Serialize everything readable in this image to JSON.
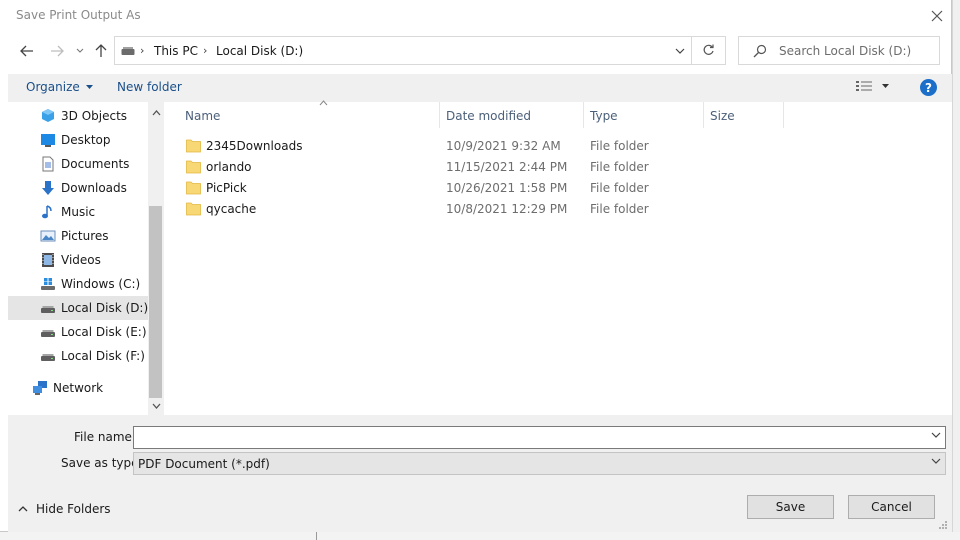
{
  "dialog": {
    "title": "Save Print Output As"
  },
  "address": {
    "crumbs": [
      "This PC",
      "Local Disk (D:)"
    ]
  },
  "search": {
    "placeholder": "Search Local Disk (D:)"
  },
  "toolbar": {
    "organize_label": "Organize",
    "new_folder_label": "New folder",
    "help_label": "?"
  },
  "sidebar": {
    "items": [
      {
        "label": "3D Objects",
        "icon": "3d-objects-icon"
      },
      {
        "label": "Desktop",
        "icon": "desktop-icon"
      },
      {
        "label": "Documents",
        "icon": "documents-icon"
      },
      {
        "label": "Downloads",
        "icon": "downloads-icon"
      },
      {
        "label": "Music",
        "icon": "music-icon"
      },
      {
        "label": "Pictures",
        "icon": "pictures-icon"
      },
      {
        "label": "Videos",
        "icon": "videos-icon"
      },
      {
        "label": "Windows (C:)",
        "icon": "windows-drive-icon"
      },
      {
        "label": "Local Disk (D:)",
        "icon": "drive-icon",
        "selected": true
      },
      {
        "label": "Local Disk (E:)",
        "icon": "drive-icon"
      },
      {
        "label": "Local Disk (F:)",
        "icon": "drive-icon"
      },
      {
        "label": "Network",
        "icon": "network-icon"
      }
    ]
  },
  "files": {
    "columns": [
      "Name",
      "Date modified",
      "Type",
      "Size"
    ],
    "rows": [
      {
        "name": "2345Downloads",
        "date": "10/9/2021 9:32 AM",
        "type": "File folder"
      },
      {
        "name": "orlando",
        "date": "11/15/2021 2:44 PM",
        "type": "File folder"
      },
      {
        "name": "PicPick",
        "date": "10/26/2021 1:58 PM",
        "type": "File folder"
      },
      {
        "name": "qycache",
        "date": "10/8/2021 12:29 PM",
        "type": "File folder"
      }
    ]
  },
  "form": {
    "file_name_label": "File name:",
    "file_name_value": "",
    "save_type_label": "Save as type:",
    "save_type_value": "PDF Document (*.pdf)"
  },
  "footer": {
    "hide_folders_label": "Hide Folders",
    "save_label": "Save",
    "cancel_label": "Cancel"
  },
  "colors": {
    "accent": "#1c6fc9",
    "selection": "#e5e5e5",
    "folder": "#f8d775"
  }
}
